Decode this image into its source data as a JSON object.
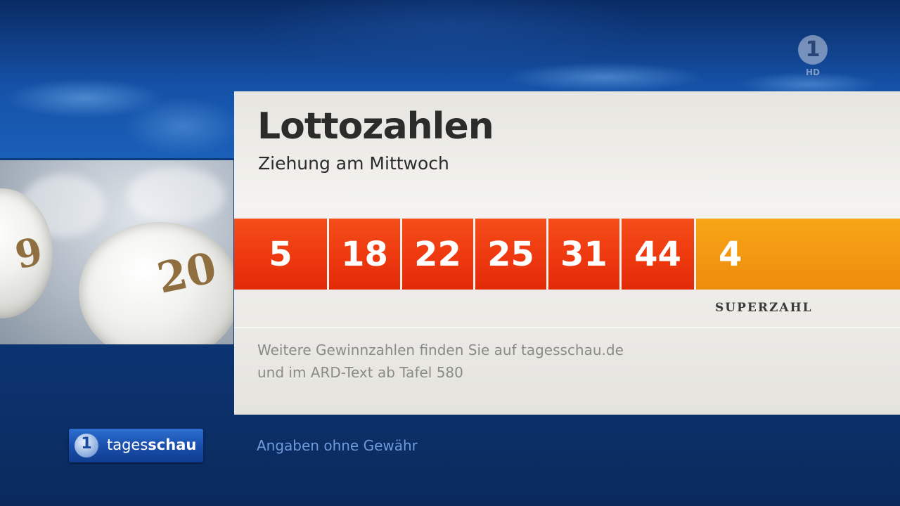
{
  "channel": {
    "badge": "HD"
  },
  "panel": {
    "title": "Lottozahlen",
    "subtitle": "Ziehung am Mittwoch",
    "numbers": [
      "5",
      "18",
      "22",
      "25",
      "31",
      "44"
    ],
    "superzahl_value": "4",
    "superzahl_label": "SUPERZAHL",
    "info_line1": "Weitere Gewinnzahlen finden Sie auf tagesschau.de",
    "info_line2": "und im ARD-Text ab Tafel 580"
  },
  "footer": {
    "logo_word_light": "tages",
    "logo_word_bold": "schau",
    "disclaimer": "Angaben ohne Gewähr"
  },
  "balls": {
    "ball_numbers": [
      "9",
      "20"
    ]
  },
  "colors": {
    "number_orange_red": "#ef3a10",
    "superzahl_orange": "#f39812",
    "background_blue": "#0f3b82"
  }
}
